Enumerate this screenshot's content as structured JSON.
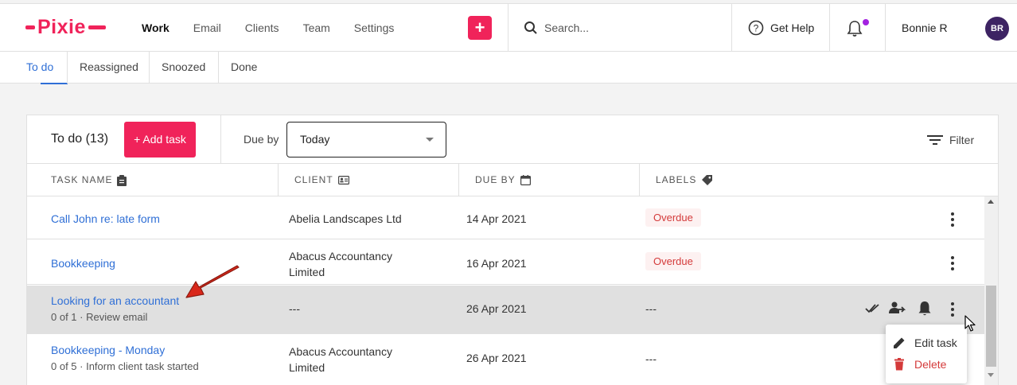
{
  "brand": {
    "name": "Pixie",
    "accent": "#f0235a"
  },
  "nav": {
    "items": [
      {
        "label": "Work",
        "active": true
      },
      {
        "label": "Email",
        "active": false
      },
      {
        "label": "Clients",
        "active": false
      },
      {
        "label": "Team",
        "active": false
      },
      {
        "label": "Settings",
        "active": false
      }
    ]
  },
  "add_button": {
    "label": "+"
  },
  "search": {
    "placeholder": "Search..."
  },
  "help": {
    "label": "Get Help"
  },
  "notifications": {
    "icon": "bell-icon",
    "unread_dot_color": "#a322e0"
  },
  "user": {
    "name": "Bonnie R",
    "initials": "BR"
  },
  "subtabs": [
    {
      "label": "To do",
      "active": true
    },
    {
      "label": "Reassigned",
      "active": false
    },
    {
      "label": "Snoozed",
      "active": false
    },
    {
      "label": "Done",
      "active": false
    }
  ],
  "toolbar": {
    "title": "To do (13)",
    "add_task_label": "+ Add task",
    "due_by_label": "Due by",
    "due_by_value": "Today",
    "filter_label": "Filter"
  },
  "columns": {
    "task_name": "TASK NAME",
    "client": "CLIENT",
    "due_by": "DUE BY",
    "labels": "LABELS"
  },
  "tasks": [
    {
      "name": "Call John re: late form",
      "subtitle": "",
      "client": "Abelia Landscapes Ltd",
      "due": "14 Apr 2021",
      "label": "Overdue"
    },
    {
      "name": "Bookkeeping",
      "subtitle": "",
      "client": "Abacus Accountancy Limited",
      "due": "16 Apr 2021",
      "label": "Overdue"
    },
    {
      "name": "Looking for an accountant",
      "subtitle": "0 of 1 · Review email",
      "client": "---",
      "due": "26 Apr 2021",
      "label": "---"
    },
    {
      "name": "Bookkeeping - Monday",
      "subtitle": "0 of 5 · Inform client task started",
      "client": "Abacus Accountancy Limited",
      "due": "26 Apr 2021",
      "label": "---"
    }
  ],
  "context_menu": {
    "edit_label": "Edit task",
    "delete_label": "Delete"
  }
}
